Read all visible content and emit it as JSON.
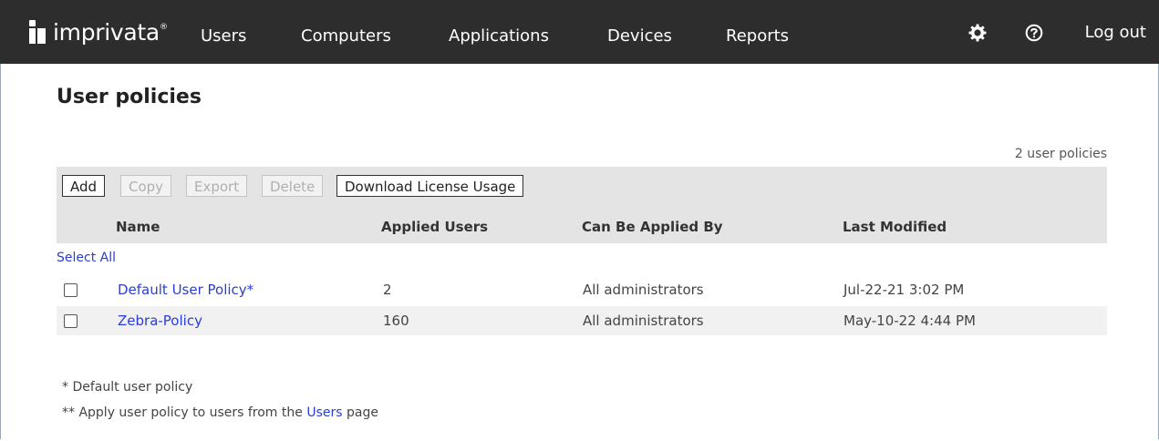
{
  "brand": {
    "name": "imprivata",
    "mark": "®"
  },
  "nav": [
    "Users",
    "Computers",
    "Applications",
    "Devices",
    "Reports"
  ],
  "header": {
    "logout_label": "Log out"
  },
  "page": {
    "title": "User policies",
    "count": "2 user policies"
  },
  "toolbar": {
    "add": "Add",
    "copy": "Copy",
    "export": "Export",
    "delete": "Delete",
    "download": "Download License Usage"
  },
  "table": {
    "columns": [
      "Name",
      "Applied Users",
      "Can Be Applied By",
      "Last Modified"
    ],
    "select_all": "Select All",
    "rows": [
      {
        "name": "Default User Policy*",
        "applied_users": "2",
        "applied_by": "All administrators",
        "last_modified": "Jul-22-21 3:02 PM"
      },
      {
        "name": "Zebra-Policy",
        "applied_users": "160",
        "applied_by": "All administrators",
        "last_modified": "May-10-22 4:44 PM"
      }
    ]
  },
  "footnotes": {
    "default": "*  Default user policy",
    "apply_prefix": "** Apply user policy to users from the ",
    "apply_link": "Users",
    "apply_suffix": " page"
  },
  "icons": {
    "settings": "gear-icon",
    "help": "help-icon"
  }
}
